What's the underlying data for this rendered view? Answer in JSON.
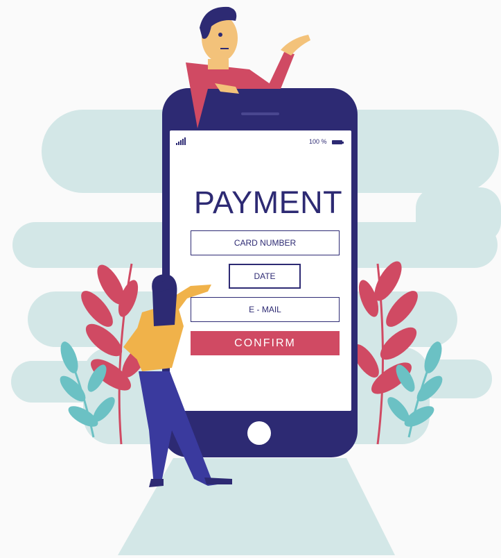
{
  "status_bar": {
    "signal_icon": "signal-bars-icon",
    "battery_percent": "100 %",
    "battery_icon": "battery-icon"
  },
  "payment_form": {
    "title": "PAYMENT",
    "card_number_placeholder": "CARD NUMBER",
    "date_placeholder": "DATE",
    "email_placeholder": "E - MAIL",
    "confirm_label": "CONFIRM"
  },
  "colors": {
    "phone_body": "#2d2a73",
    "screen": "#ffffff",
    "accent": "#d04a63",
    "cloud": "#d3e7e7",
    "leaf_teal": "#6bc1c4",
    "leaf_red": "#d04a63",
    "shirt_yellow": "#f0b24a",
    "pants_blue": "#3a3a9e"
  }
}
